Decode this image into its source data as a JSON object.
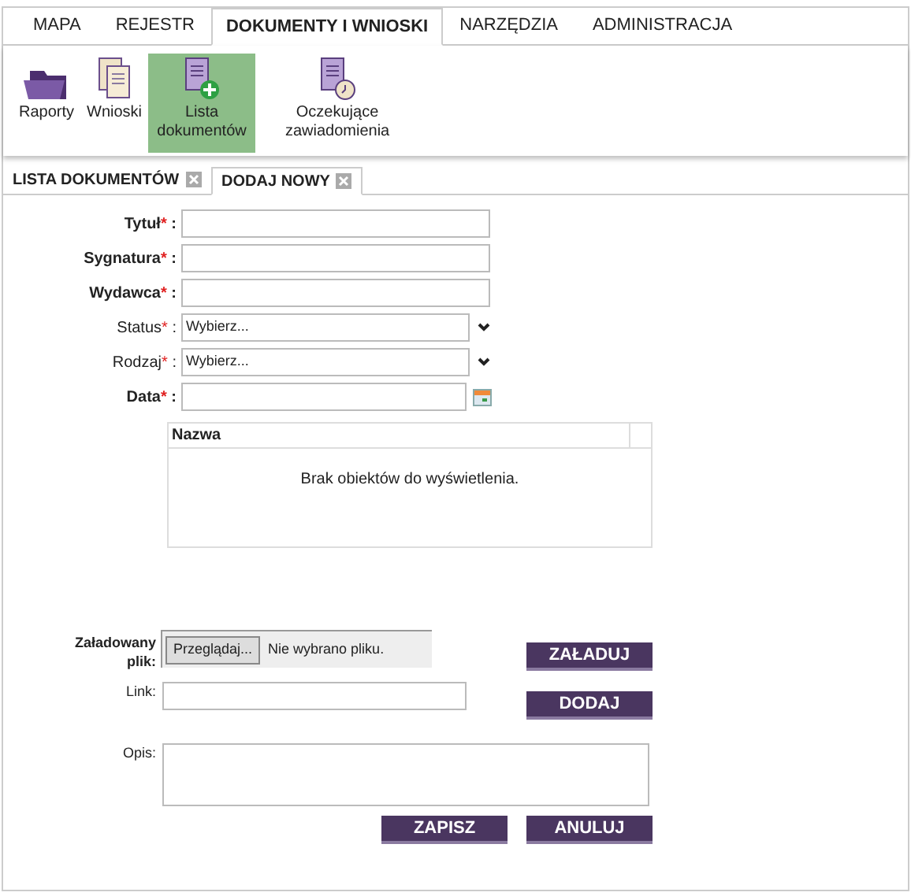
{
  "main_tabs": [
    {
      "label": "MAPA",
      "selected": false
    },
    {
      "label": "REJESTR",
      "selected": false
    },
    {
      "label": "DOKUMENTY I WNIOSKI",
      "selected": true
    },
    {
      "label": "NARZĘDZIA",
      "selected": false
    },
    {
      "label": "ADMINISTRACJA",
      "selected": false
    }
  ],
  "ribbon": [
    {
      "label": "Raporty",
      "kind": "folder",
      "selected": false
    },
    {
      "label": "Wnioski",
      "kind": "pages",
      "selected": false
    },
    {
      "label": "Lista dokumentów",
      "kind": "add",
      "selected": true
    },
    {
      "label": "Oczekujące zawiadomienia",
      "kind": "clock",
      "selected": false
    }
  ],
  "sub_tabs": [
    {
      "label": "LISTA DOKUMENTÓW",
      "selected": false
    },
    {
      "label": "DODAJ NOWY",
      "selected": true
    }
  ],
  "fields": [
    {
      "label": "Tytuł",
      "bold": true,
      "kind": "text"
    },
    {
      "label": "Sygnatura",
      "bold": true,
      "kind": "text"
    },
    {
      "label": "Wydawca",
      "bold": true,
      "kind": "text"
    },
    {
      "label": "Status",
      "bold": false,
      "kind": "select",
      "value": "Wybierz..."
    },
    {
      "label": "Rodzaj",
      "bold": false,
      "kind": "select",
      "value": "Wybierz..."
    },
    {
      "label": "Data",
      "bold": true,
      "kind": "date"
    }
  ],
  "required_mark": "*",
  "label_sep": ":",
  "table": {
    "columns": [
      "Nazwa"
    ],
    "empty_text": "Brak obiektów do wyświetlenia."
  },
  "upload": {
    "label": "Załadowany plik:",
    "browse": "Przeglądaj...",
    "status": "Nie wybrano pliku.",
    "button": "ZAŁADUJ"
  },
  "link": {
    "label": "Link:",
    "button": "DODAJ"
  },
  "description": {
    "label": "Opis:"
  },
  "buttons": [
    "ZAPISZ",
    "ANULUJ"
  ]
}
